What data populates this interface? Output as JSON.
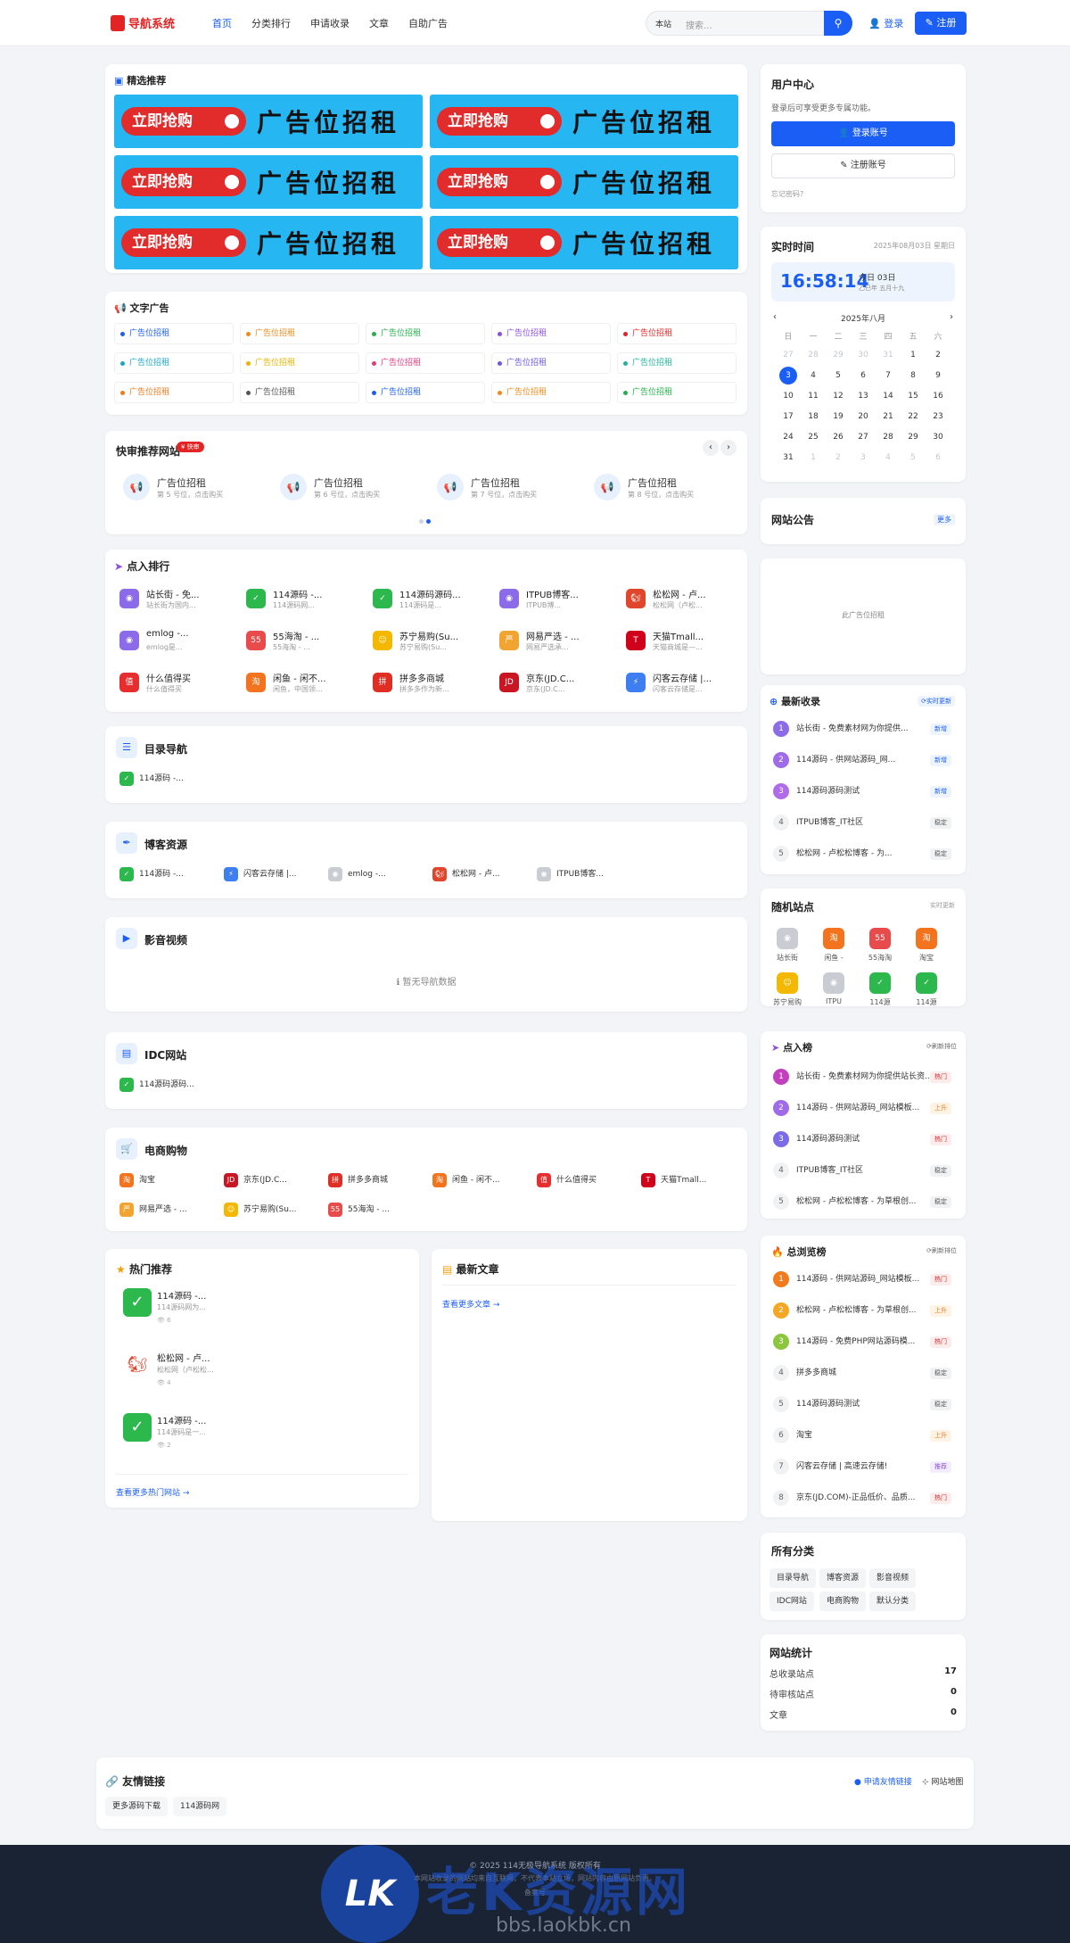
{
  "header": {
    "logo": "导航系统",
    "nav": [
      "首页",
      "分类排行",
      "申请收录",
      "文章",
      "自助广告"
    ],
    "search_scope": "本站",
    "search_placeholder": "搜索...",
    "login": "登录",
    "register": "注册"
  },
  "featured": {
    "title": "精选推荐",
    "banner_button": "立即抢购",
    "banner_text": "广告位招租"
  },
  "text_ads": {
    "title": "文字广告",
    "items": [
      {
        "label": "广告位招租",
        "color": "#1b5ef6"
      },
      {
        "label": "广告位招租",
        "color": "#f08a1c"
      },
      {
        "label": "广告位招租",
        "color": "#22b14c"
      },
      {
        "label": "广告位招租",
        "color": "#8c4fe0"
      },
      {
        "label": "广告位招租",
        "color": "#e32424"
      },
      {
        "label": "广告位招租",
        "color": "#1aa6c8"
      },
      {
        "label": "广告位招租",
        "color": "#e8b400"
      },
      {
        "label": "广告位招租",
        "color": "#e83a79"
      },
      {
        "label": "广告位招租",
        "color": "#6a5ae0"
      },
      {
        "label": "广告位招租",
        "color": "#1fb59a"
      },
      {
        "label": "广告位招租",
        "color": "#f07a1c"
      },
      {
        "label": "广告位招租",
        "color": "#555555"
      },
      {
        "label": "广告位招租",
        "color": "#1b5ef6"
      },
      {
        "label": "广告位招租",
        "color": "#f08a1c"
      },
      {
        "label": "广告位招租",
        "color": "#22b14c"
      }
    ]
  },
  "quick": {
    "title": "快审推荐网站",
    "badge": "¥ 快审",
    "items": [
      {
        "title": "广告位招租",
        "sub": "第 5 号位，点击购买"
      },
      {
        "title": "广告位招租",
        "sub": "第 6 号位，点击购买"
      },
      {
        "title": "广告位招租",
        "sub": "第 7 号位，点击购买"
      },
      {
        "title": "广告位招租",
        "sub": "第 8 号位，点击购买"
      }
    ]
  },
  "click_rank": {
    "title": "点入排行",
    "items": [
      {
        "title": "站长街 - 免...",
        "sub": "站长街为国内...",
        "icon": "globe-icon",
        "color": "#8c6be8"
      },
      {
        "title": "114源码 -...",
        "sub": "114源码网...",
        "icon": "check-icon",
        "color": "#2db84d"
      },
      {
        "title": "114源码源码...",
        "sub": "114源码是...",
        "icon": "check-icon",
        "color": "#2db84d"
      },
      {
        "title": "ITPUB博客...",
        "sub": "ITPUB博...",
        "icon": "globe-icon",
        "color": "#8c6be8"
      },
      {
        "title": "松松网 - 卢...",
        "sub": "松松网（卢松...",
        "icon": "squirrel-icon",
        "color": "#e0462b"
      },
      {
        "title": "emlog -...",
        "sub": "emlog是...",
        "icon": "globe-icon",
        "color": "#8c6be8"
      },
      {
        "title": "55海淘 - ...",
        "sub": "55海淘 - ...",
        "icon": "55-icon",
        "color": "#e84b4b"
      },
      {
        "title": "苏宁易购(Su...",
        "sub": "苏宁易购(Su...",
        "icon": "suning-icon",
        "color": "#f5b800"
      },
      {
        "title": "网易严选 - ...",
        "sub": "网易严选承...",
        "icon": "yanxuan-icon",
        "color": "#f2a431"
      },
      {
        "title": "天猫Tmall...",
        "sub": "天猫商城是—...",
        "icon": "tmall-icon",
        "color": "#d0021b"
      },
      {
        "title": "什么值得买",
        "sub": "什么值得买",
        "icon": "smzdm-icon",
        "color": "#e62e2e"
      },
      {
        "title": "闲鱼 - 闲不...",
        "sub": "闲鱼，中国领...",
        "icon": "taobao-icon",
        "color": "#f4731f"
      },
      {
        "title": "拼多多商城",
        "sub": "拼多多作为新...",
        "icon": "pdd-icon",
        "color": "#e02e24"
      },
      {
        "title": "京东(JD.C...",
        "sub": "京东(JD.C...",
        "icon": "jd-icon",
        "color": "#c91623"
      },
      {
        "title": "闪客云存储 |...",
        "sub": "闪客云存储是...",
        "icon": "bolt-icon",
        "color": "#3d7ff0"
      }
    ]
  },
  "dir_nav": {
    "title": "目录导航",
    "items": [
      "114源码 -..."
    ]
  },
  "blog": {
    "title": "博客资源",
    "items": [
      "114源码 -...",
      "闪客云存储 |...",
      "emlog -...",
      "松松网 - 卢...",
      "ITPUB博客..."
    ]
  },
  "video": {
    "title": "影音视频",
    "empty": "暂无导航数据"
  },
  "idc": {
    "title": "IDC网站",
    "items": [
      "114源码源码..."
    ]
  },
  "shop": {
    "title": "电商购物",
    "items": [
      "淘宝",
      "京东(JD.C...",
      "拼多多商城",
      "闲鱼 - 闲不...",
      "什么值得买",
      "天猫Tmall...",
      "网易严选 - ...",
      "苏宁易购(Su...",
      "55海淘 - ..."
    ]
  },
  "hot": {
    "title": "热门推荐",
    "items": [
      {
        "title": "114源码 -...",
        "sub": "114源码网为...",
        "views": "6"
      },
      {
        "title": "松松网 - 卢...",
        "sub": "松松网（卢松松...",
        "views": "4"
      },
      {
        "title": "114源码 -...",
        "sub": "114源码是一...",
        "views": "2"
      }
    ],
    "more": "查看更多热门网站"
  },
  "articles": {
    "title": "最新文章",
    "more": "查看更多文章"
  },
  "user": {
    "title": "用户中心",
    "desc": "登录后可享受更多专属功能。",
    "login": "登录账号",
    "register": "注册账号",
    "forgot": "忘记密码?"
  },
  "clock": {
    "title": "实时时间",
    "date": "2025年08月03日 星期日",
    "time": "16:58:14",
    "today": "今日 03日",
    "lunar": "乙巳年 五月十九",
    "month": "2025年八月",
    "weekdays": [
      "日",
      "一",
      "二",
      "三",
      "四",
      "五",
      "六"
    ],
    "days": [
      [
        "27",
        "28",
        "29",
        "30",
        "31",
        "1",
        "2"
      ],
      [
        "3",
        "4",
        "5",
        "6",
        "7",
        "8",
        "9"
      ],
      [
        "10",
        "11",
        "12",
        "13",
        "14",
        "15",
        "16"
      ],
      [
        "17",
        "18",
        "19",
        "20",
        "21",
        "22",
        "23"
      ],
      [
        "24",
        "25",
        "26",
        "27",
        "28",
        "29",
        "30"
      ],
      [
        "31",
        "1",
        "2",
        "3",
        "4",
        "5",
        "6"
      ]
    ]
  },
  "notice": {
    "title": "网站公告",
    "more": "更多"
  },
  "side_ad": {
    "text": "此广告位招租"
  },
  "latest": {
    "title": "最新收录",
    "action": "实时更新",
    "items": [
      {
        "n": "1",
        "title": "站长街 - 免费素材网为你提供...",
        "badge": "新增"
      },
      {
        "n": "2",
        "title": "114源码 - 供网站源码_网...",
        "badge": "新增"
      },
      {
        "n": "3",
        "title": "114源码源码测试",
        "badge": "新增"
      },
      {
        "n": "4",
        "title": "ITPUB博客_IT社区",
        "badge": "稳定"
      },
      {
        "n": "5",
        "title": "松松网 - 卢松松博客 - 为...",
        "badge": "稳定"
      }
    ]
  },
  "random": {
    "title": "随机站点",
    "action": "实时更新",
    "items": [
      {
        "label": "站长街",
        "icon": "globe-icon",
        "color": "#c9ccd2"
      },
      {
        "label": "闲鱼 -",
        "icon": "taobao-icon",
        "color": "#f4731f"
      },
      {
        "label": "55海淘",
        "icon": "55-icon",
        "color": "#e84b4b"
      },
      {
        "label": "淘宝",
        "icon": "taobao-icon",
        "color": "#f4731f"
      },
      {
        "label": "苏宁易购",
        "icon": "suning-icon",
        "color": "#f5b800"
      },
      {
        "label": "ITPU",
        "icon": "globe-icon",
        "color": "#c9ccd2"
      },
      {
        "label": "114源",
        "icon": "check-icon",
        "color": "#2db84d"
      },
      {
        "label": "114源",
        "icon": "check-icon",
        "color": "#2db84d"
      }
    ]
  },
  "click_board": {
    "title": "点入榜",
    "action": "刷新排位",
    "items": [
      {
        "n": "1",
        "title": "站长街 - 免费素材网为你提供站长资...",
        "badge": "热门"
      },
      {
        "n": "2",
        "title": "114源码 - 供网站源码_网站模板...",
        "badge": "上升"
      },
      {
        "n": "3",
        "title": "114源码源码测试",
        "badge": "热门"
      },
      {
        "n": "4",
        "title": "ITPUB博客_IT社区",
        "badge": "稳定"
      },
      {
        "n": "5",
        "title": "松松网 - 卢松松博客 - 为草根创...",
        "badge": "稳定"
      }
    ]
  },
  "view_board": {
    "title": "总浏览榜",
    "action": "刷新排位",
    "items": [
      {
        "n": "1",
        "title": "114源码 - 供网站源码_网站模板...",
        "badge": "热门"
      },
      {
        "n": "2",
        "title": "松松网 - 卢松松博客 - 为草根创...",
        "badge": "上升"
      },
      {
        "n": "3",
        "title": "114源码 - 免费PHP网站源码模...",
        "badge": "热门"
      },
      {
        "n": "4",
        "title": "拼多多商城",
        "badge": "稳定"
      },
      {
        "n": "5",
        "title": "114源码源码测试",
        "badge": "稳定"
      },
      {
        "n": "6",
        "title": "淘宝",
        "badge": "上升"
      },
      {
        "n": "7",
        "title": "闪客云存储 | 高速云存储!",
        "badge": "推荐"
      },
      {
        "n": "8",
        "title": "京东(JD.COM)-正品低价、品质...",
        "badge": "热门"
      }
    ]
  },
  "categories": {
    "title": "所有分类",
    "items": [
      "目录导航",
      "博客资源",
      "影音视频",
      "IDC网站",
      "电商购物",
      "默认分类"
    ]
  },
  "stats": {
    "title": "网站统计",
    "rows": [
      {
        "label": "总收录站点",
        "value": "17"
      },
      {
        "label": "待审核站点",
        "value": "0"
      },
      {
        "label": "文章",
        "value": "0"
      }
    ]
  },
  "friends": {
    "title": "友情链接",
    "apply": "申请友情链接",
    "sitemap": "网站地图",
    "items": [
      "更多源码下载",
      "114源码网"
    ]
  },
  "footer": {
    "copyright": "© 2025 114无极导航系统 版权所有",
    "disclaimer": "本网站收录的网站均来自互联网，不代表本站立场，网站内容由原网站负责。",
    "link": "备案号"
  },
  "watermark": {
    "brand": "老K资源网",
    "url": "bbs.laokbk.cn"
  }
}
